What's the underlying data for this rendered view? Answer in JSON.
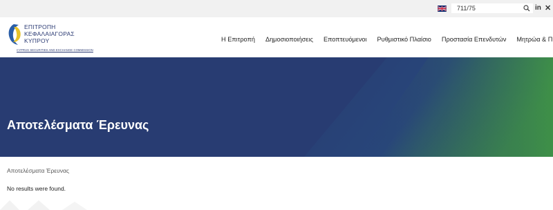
{
  "topbar": {
    "language_flag": "uk-flag-icon",
    "search_value": "711/75",
    "search_icon": "search-icon",
    "social": {
      "linkedin_label": "in",
      "x_label": "𝕏"
    }
  },
  "logo": {
    "lines": [
      "ΕΠΙΤΡΟΠΗ",
      "ΚΕΦΑΛΑΙΑΓΟΡΑΣ",
      "ΚΥΠΡΟΥ"
    ],
    "subtitle": "CYPRUS SECURITIES AND EXCHANGE COMMISSION"
  },
  "nav": {
    "items": [
      "Η Επιτροπή",
      "Δημοσιοποιήσεις",
      "Εποπτευόμενοι",
      "Ρυθμιστικό Πλαίσιο",
      "Προστασία Επενδυτών",
      "Μητρώα & Πύλες"
    ]
  },
  "hero": {
    "title": "Αποτελέσματα Έρευνας",
    "colors": {
      "base": "#283c72",
      "accent": "#3a8a47"
    }
  },
  "content": {
    "breadcrumb": "Αποτελέσματα Έρευνας",
    "message": "No results were found."
  }
}
